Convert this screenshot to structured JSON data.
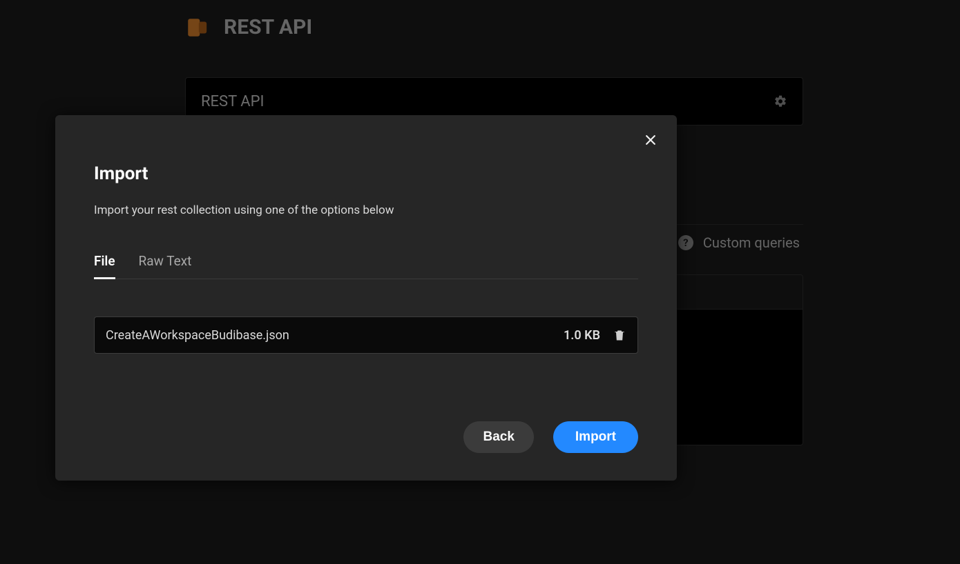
{
  "background": {
    "datasource_title": "REST API",
    "name_field_value": "REST API",
    "custom_queries_label": "Custom queries"
  },
  "modal": {
    "title": "Import",
    "subtitle": "Import your rest collection using one of the options below",
    "tabs": [
      {
        "label": "File",
        "active": true
      },
      {
        "label": "Raw Text",
        "active": false
      }
    ],
    "file": {
      "name": "CreateAWorkspaceBudibase.json",
      "size": "1.0 KB"
    },
    "actions": {
      "back": "Back",
      "import": "Import"
    }
  }
}
